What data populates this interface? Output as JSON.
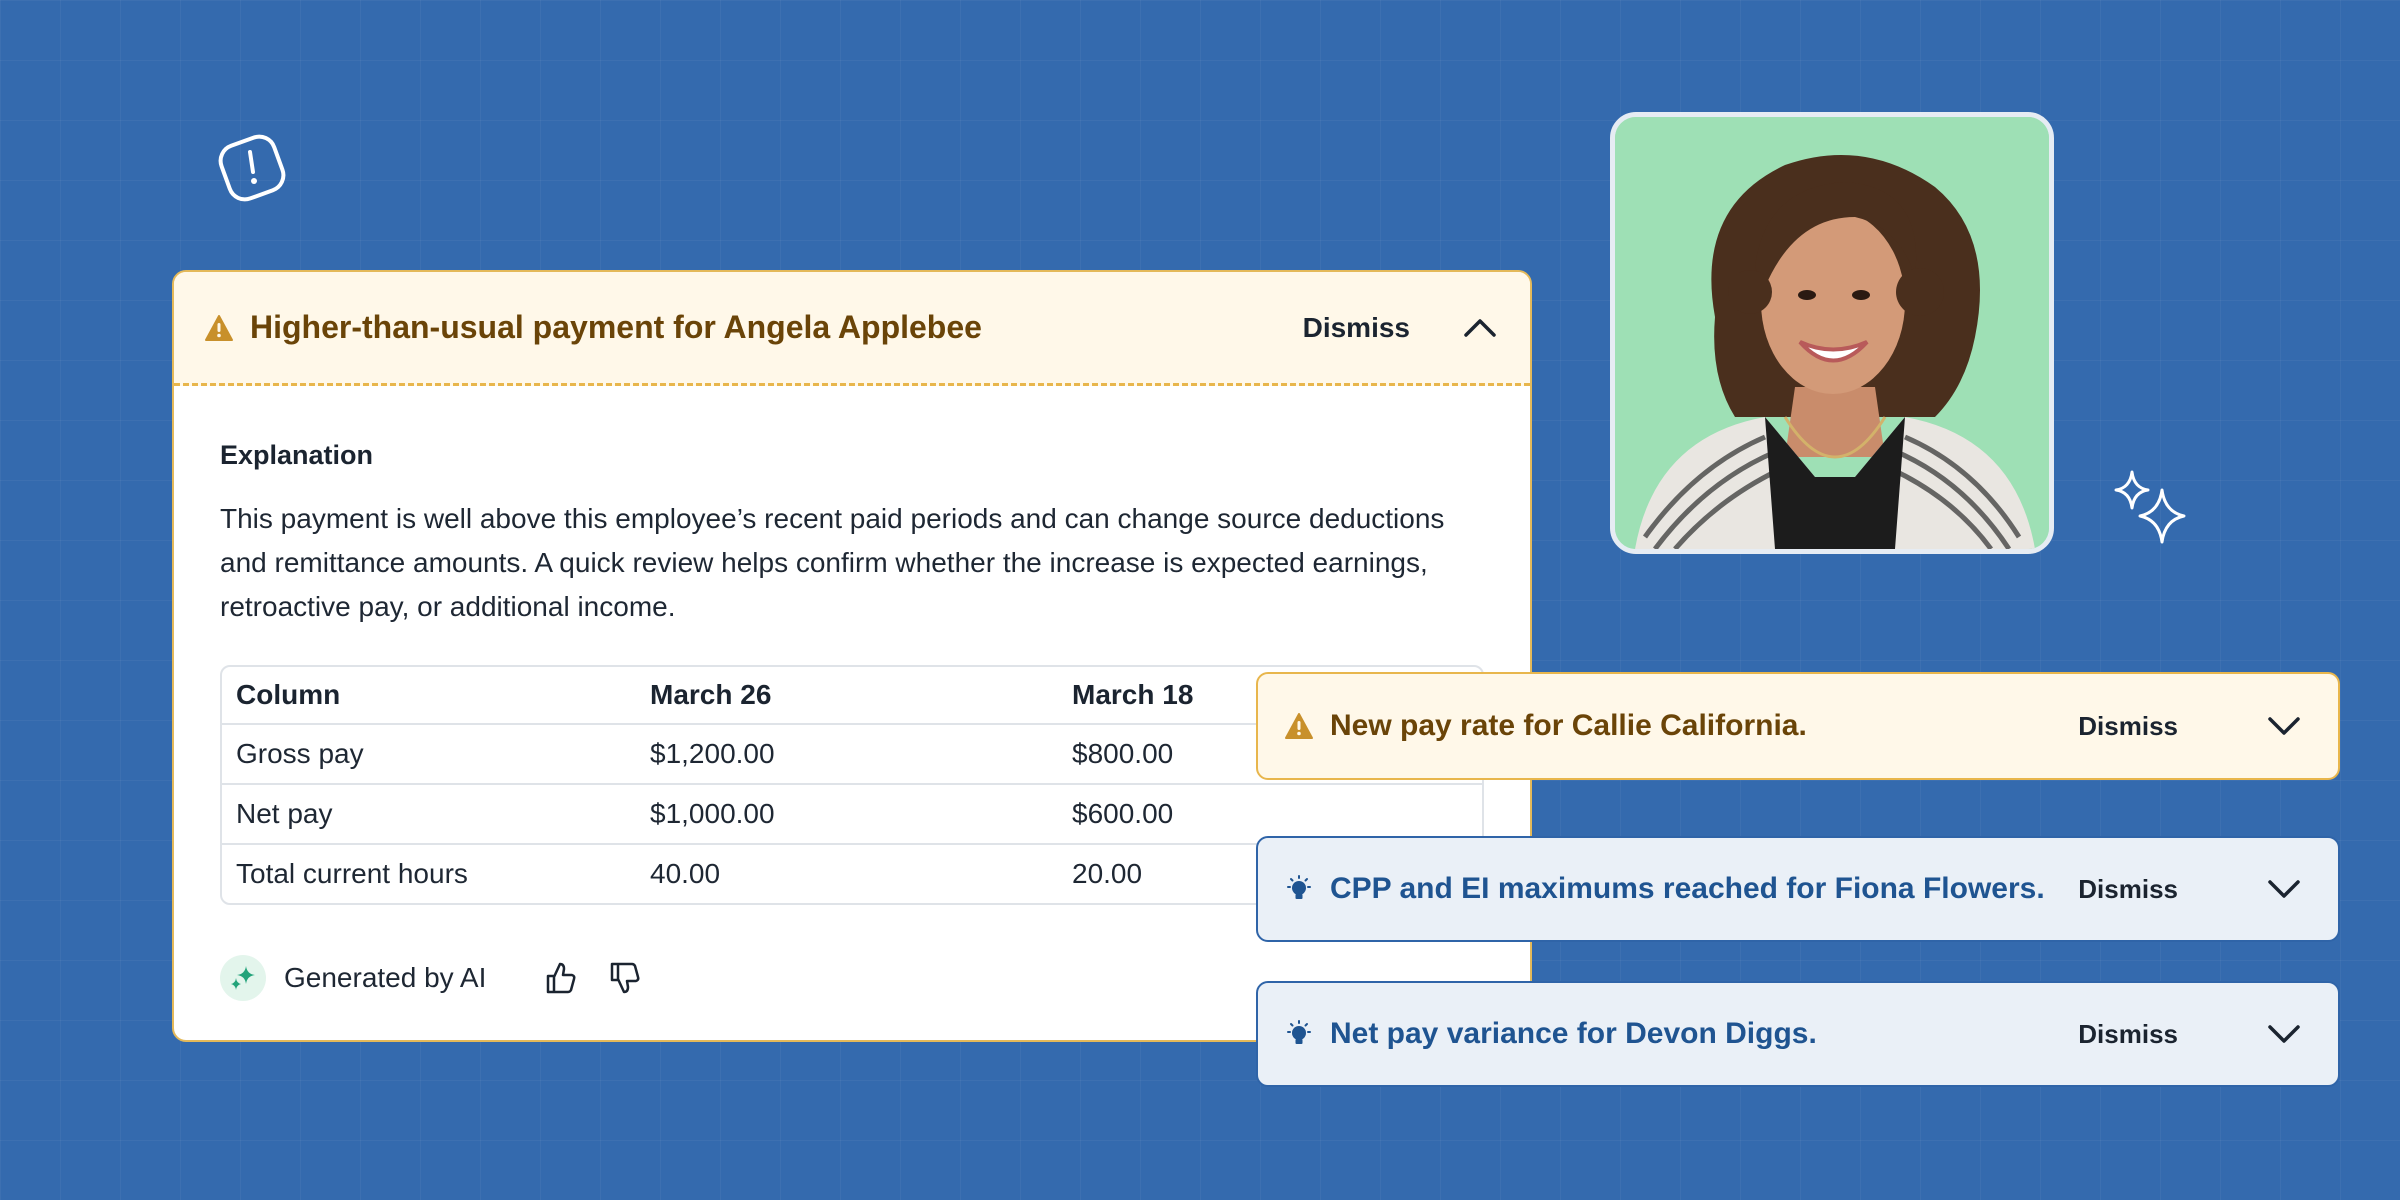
{
  "alert_card": {
    "title": "Higher-than-usual payment for Angela Applebee",
    "dismiss_label": "Dismiss",
    "explanation_label": "Explanation",
    "explanation_text": "This payment is well above this employee’s recent paid periods and can change source deductions and remittance amounts. A quick review helps confirm whether the increase is expected earnings, retroactive pay, or additional income.",
    "table": {
      "headers": [
        "Column",
        "March 26",
        "March 18"
      ],
      "rows": [
        [
          "Gross pay",
          "$1,200.00",
          "$800.00"
        ],
        [
          "Net pay",
          "$1,000.00",
          "$600.00"
        ],
        [
          "Total current hours",
          "40.00",
          "20.00"
        ]
      ]
    },
    "footer": {
      "generated_label": "Generated by AI"
    }
  },
  "alerts": [
    {
      "title": "New pay rate for Callie California.",
      "dismiss_label": "Dismiss",
      "kind": "warning",
      "icon": "warning-icon"
    },
    {
      "title": "CPP and EI maximums reached for Fiona Flowers.",
      "dismiss_label": "Dismiss",
      "kind": "info",
      "icon": "lightbulb-icon"
    },
    {
      "title": "Net pay variance for Devon Diggs.",
      "dismiss_label": "Dismiss",
      "kind": "info",
      "icon": "lightbulb-icon"
    }
  ],
  "colors": {
    "background": "#346aae",
    "warning_bg": "#fff8e9",
    "warning_border": "#e8b64c",
    "warning_text": "#6a4408",
    "info_bg": "#eaf0f7",
    "info_text": "#1f5491",
    "photo_bg": "#9ee0b5"
  }
}
